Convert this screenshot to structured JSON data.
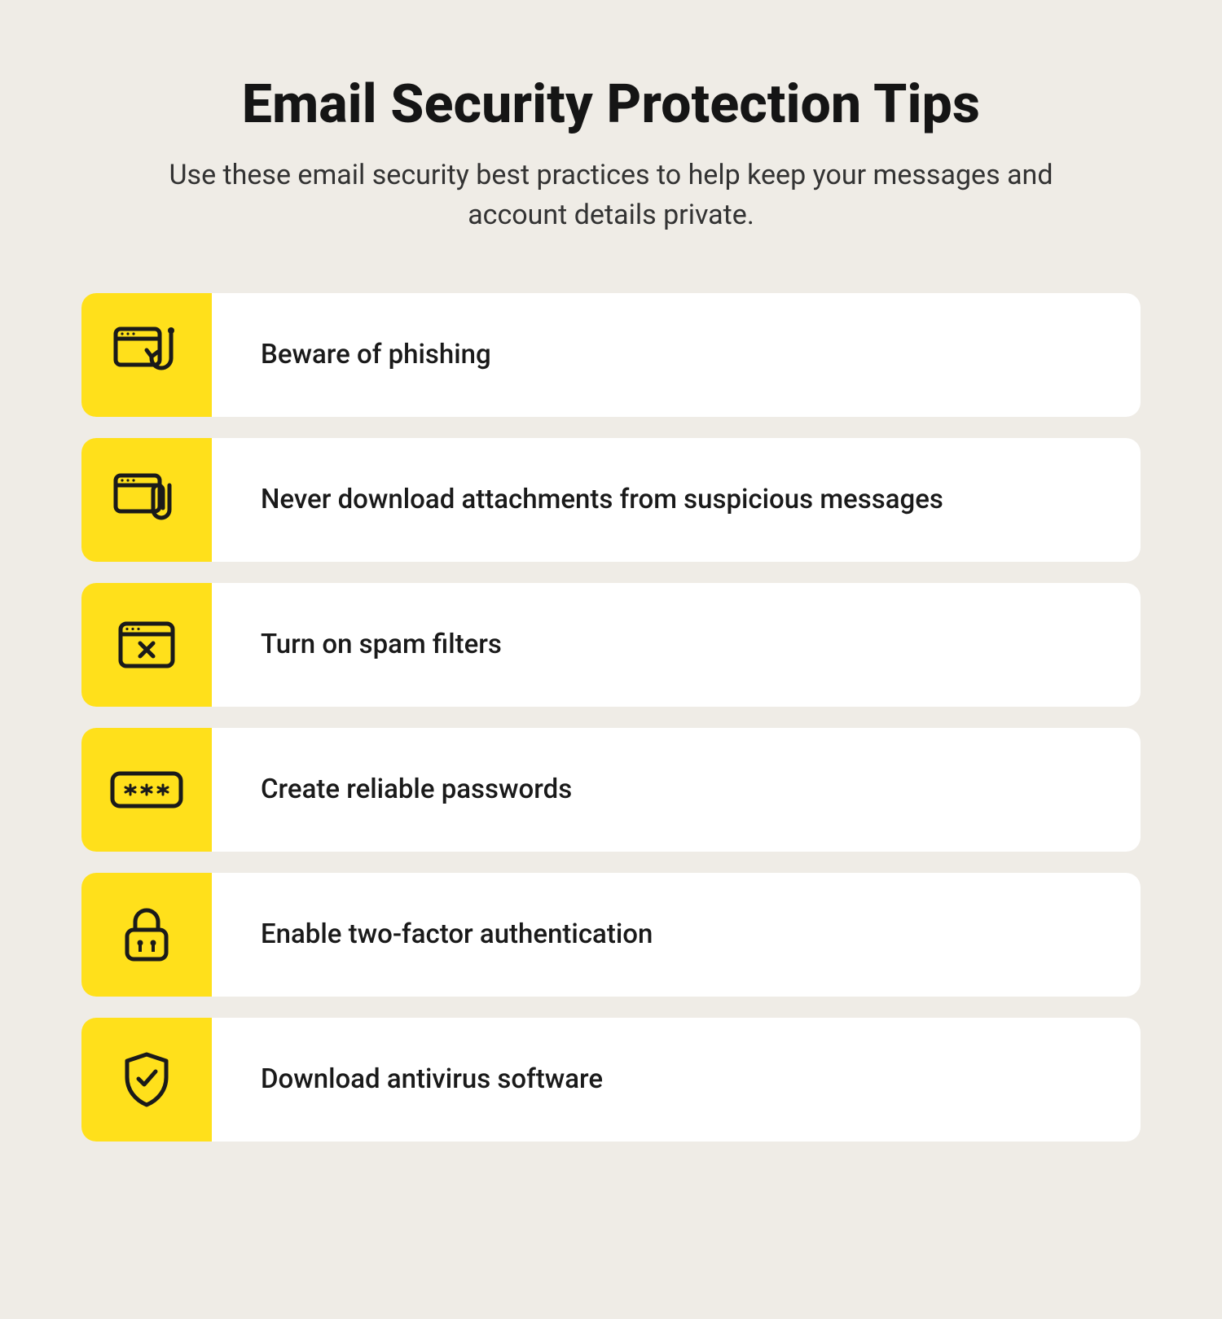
{
  "header": {
    "title": "Email Security Protection Tips",
    "subtitle": "Use these email security best practices to help keep your messages and account details private."
  },
  "tips": [
    {
      "icon": "phishing-icon",
      "label": "Beware of phishing"
    },
    {
      "icon": "attachment-icon",
      "label": "Never download attachments from suspicious messages"
    },
    {
      "icon": "spam-icon",
      "label": "Turn on spam filters"
    },
    {
      "icon": "password-icon",
      "label": "Create reliable passwords"
    },
    {
      "icon": "lock-icon",
      "label": "Enable two-factor authentication"
    },
    {
      "icon": "shield-icon",
      "label": "Download antivirus software"
    }
  ],
  "colors": {
    "background": "#efece6",
    "accent": "#ffe01b",
    "card": "#ffffff",
    "text": "#1a1a1a"
  }
}
